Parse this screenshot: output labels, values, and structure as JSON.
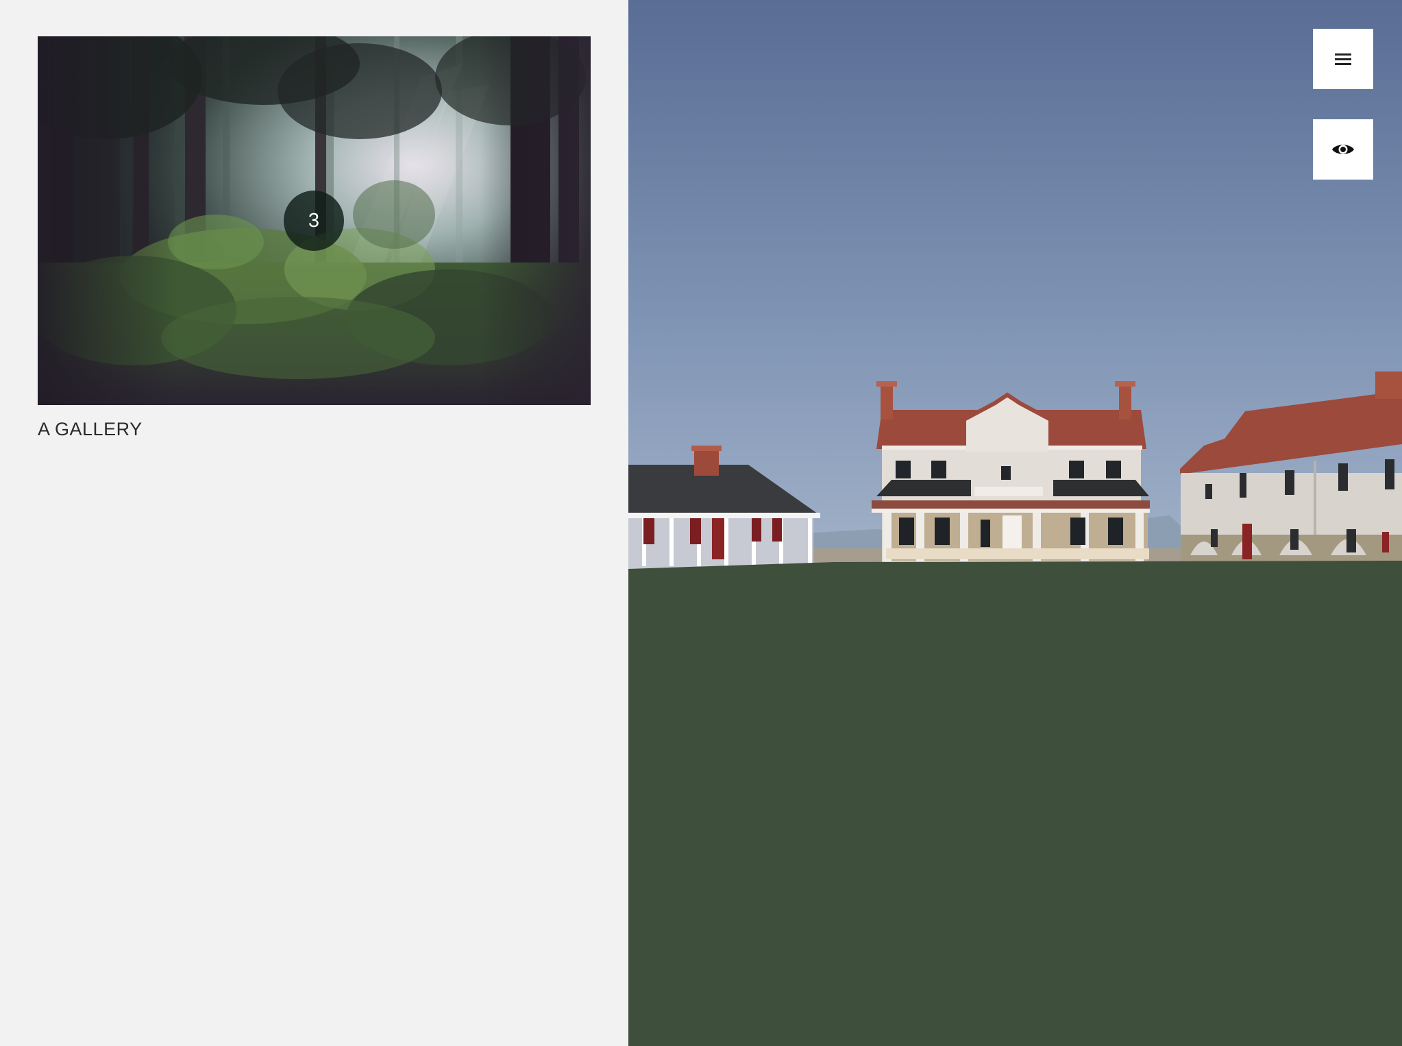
{
  "gallery": {
    "title": "A GALLERY",
    "item_count": "3",
    "thumbnail_icon": "forest-photo"
  },
  "controls": {
    "menu_icon": "hamburger-menu-icon",
    "view_icon": "eye-icon"
  },
  "scene": {
    "description_icon": "3d-building-scene"
  },
  "colors": {
    "page_background": "#f2f2f2",
    "sky_top": "#5a6e96",
    "grass": "#3e4f3b",
    "roof": "#9c4a3c",
    "badge": "#101e18"
  }
}
